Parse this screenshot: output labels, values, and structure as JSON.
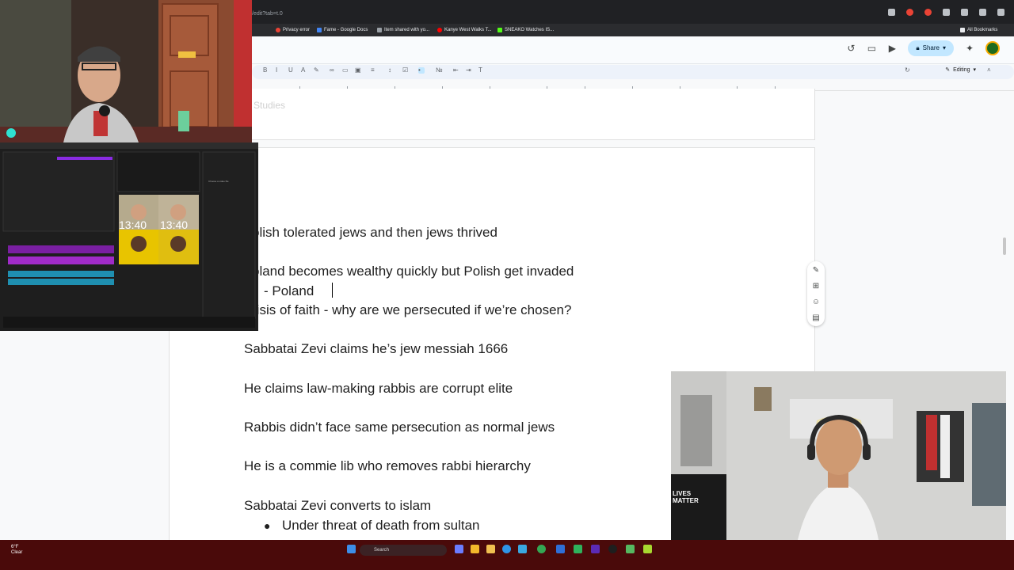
{
  "browser": {
    "url": "/edit?tab=t.0",
    "bookmarks": [
      "Privacy error",
      "Fame - Google Docs",
      "Item shared with yo...",
      "Kanye West Walks T...",
      "SNEAKO Watches IS..."
    ],
    "all_bookmarks": "All Bookmarks",
    "colors": {
      "tabstrip": "#202124",
      "bookmarks_bar": "#2b2c2f"
    }
  },
  "docs": {
    "share_label": "Share",
    "editing_label": "Editing",
    "page1_fragment": "Studies",
    "icons": [
      "history-icon",
      "comment-icon",
      "video-call-icon",
      "lock-icon",
      "gemini-icon",
      "pencil-icon",
      "expand-icon"
    ]
  },
  "document": {
    "lines": [
      "olish tolerated jews and then jews thrived",
      "oland becomes wealthy quickly but Polish get invaded",
      "-    Poland",
      "risis of faith - why are we persecuted if we’re chosen?",
      "Sabbatai Zevi claims he’s jew messiah 1666",
      "He claims law-making rabbis are corrupt elite",
      "Rabbis didn’t face same persecution as normal jews",
      "He is a commie lib who removes rabbi hierarchy",
      "Sabbatai Zevi converts to islam",
      "Under threat of death from sultan"
    ],
    "bullet": "●"
  },
  "overlays": {
    "video_timer_1": "13:40",
    "video_timer_2": "13:40",
    "editor_mini_label": "Choose a video file",
    "shirt_text": "LIVES MATTER"
  },
  "taskbar": {
    "weather_temp": "6°F",
    "weather_desc": "Clear",
    "search_placeholder": "Search"
  }
}
